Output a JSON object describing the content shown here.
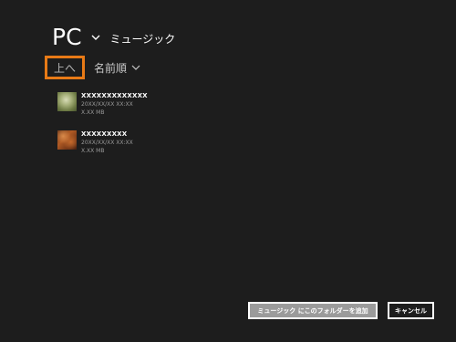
{
  "header": {
    "location": "PC",
    "location_chevron_icon": "chevron-down-icon",
    "subtitle": "ミュージック"
  },
  "toolbar": {
    "up_label": "上へ",
    "sort_label": "名前順",
    "sort_chevron_icon": "chevron-down-icon",
    "accent_color": "#e87a16"
  },
  "files": [
    {
      "name": "XXXXXXXXXXXXX",
      "date": "20XX/XX/XX XX:XX",
      "size": "X.XX MB"
    },
    {
      "name": "XXXXXXXXX",
      "date": "20XX/XX/XX XX:XX",
      "size": "X.XX MB"
    }
  ],
  "footer": {
    "add_label": "ミュージック にこのフォルダーを追加",
    "cancel_label": "キャンセル"
  }
}
